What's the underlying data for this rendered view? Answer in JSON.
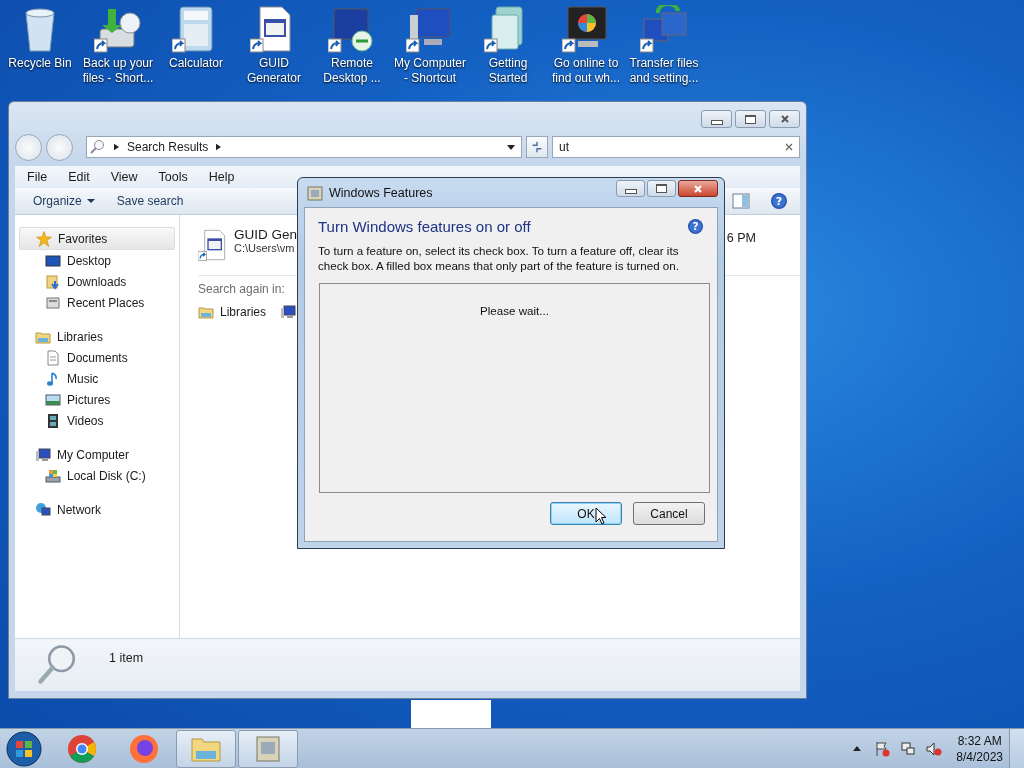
{
  "desktop_icons": [
    {
      "label": "Recycle Bin",
      "kind": "bin",
      "shortcut": false
    },
    {
      "label": "Back up your files - Short...",
      "kind": "backup",
      "shortcut": true
    },
    {
      "label": "Calculator",
      "kind": "calculator",
      "shortcut": true
    },
    {
      "label": "GUID Generator",
      "kind": "document",
      "shortcut": true
    },
    {
      "label": "Remote Desktop ...",
      "kind": "remote",
      "shortcut": true
    },
    {
      "label": "My Computer - Shortcut",
      "kind": "computer",
      "shortcut": true
    },
    {
      "label": "Getting Started",
      "kind": "pages",
      "shortcut": true
    },
    {
      "label": "Go online to find out wh...",
      "kind": "monitor",
      "shortcut": true
    },
    {
      "label": "Transfer files and setting...",
      "kind": "transfer",
      "shortcut": true
    }
  ],
  "explorer": {
    "address": {
      "crumbs": [
        "Search Results"
      ]
    },
    "search": {
      "value": "ut"
    },
    "menu": [
      "File",
      "Edit",
      "View",
      "Tools",
      "Help"
    ],
    "help_glyph": "?",
    "commands": [
      {
        "label": "Organize",
        "dropdown": true
      },
      {
        "label": "Save search",
        "dropdown": false
      }
    ],
    "nav": [
      {
        "label": "Favorites",
        "kind": "star",
        "highlighted": true,
        "children": [
          {
            "label": "Desktop",
            "kind": "desktop"
          },
          {
            "label": "Downloads",
            "kind": "downloads"
          },
          {
            "label": "Recent Places",
            "kind": "recent"
          }
        ]
      },
      {
        "label": "Libraries",
        "kind": "library",
        "highlighted": false,
        "children": [
          {
            "label": "Documents",
            "kind": "documents"
          },
          {
            "label": "Music",
            "kind": "music"
          },
          {
            "label": "Pictures",
            "kind": "pictures"
          },
          {
            "label": "Videos",
            "kind": "videos"
          }
        ]
      },
      {
        "label": "My Computer",
        "kind": "computer",
        "highlighted": false,
        "children": [
          {
            "label": "Local Disk (C:)",
            "kind": "disk"
          }
        ]
      },
      {
        "label": "Network",
        "kind": "network",
        "highlighted": false
      }
    ],
    "result": {
      "name": "GUID Gen",
      "path": "C:\\Users\\vm",
      "time": "6 PM"
    },
    "search_again": {
      "label": "Search again in:",
      "locations": [
        {
          "label": "Libraries",
          "kind": "library"
        },
        {
          "kind": "computer"
        }
      ]
    },
    "status": "1 item"
  },
  "dialog": {
    "title": "Windows Features",
    "heading": "Turn Windows features on or off",
    "help_glyph": "?",
    "description": "To turn a feature on, select its check box. To turn a feature off, clear its check box. A filled box means that only part of the feature is turned on.",
    "list_message": "Please wait...",
    "buttons": [
      {
        "label": "OK",
        "default": true
      },
      {
        "label": "Cancel",
        "default": false
      }
    ]
  },
  "taskbar": {
    "apps": [
      {
        "kind": "chrome",
        "running": false
      },
      {
        "kind": "firefox",
        "running": false
      },
      {
        "kind": "explorer",
        "running": true
      },
      {
        "kind": "features",
        "running": true
      }
    ],
    "clock": {
      "time": "8:32 AM",
      "date": "8/4/2023"
    }
  }
}
